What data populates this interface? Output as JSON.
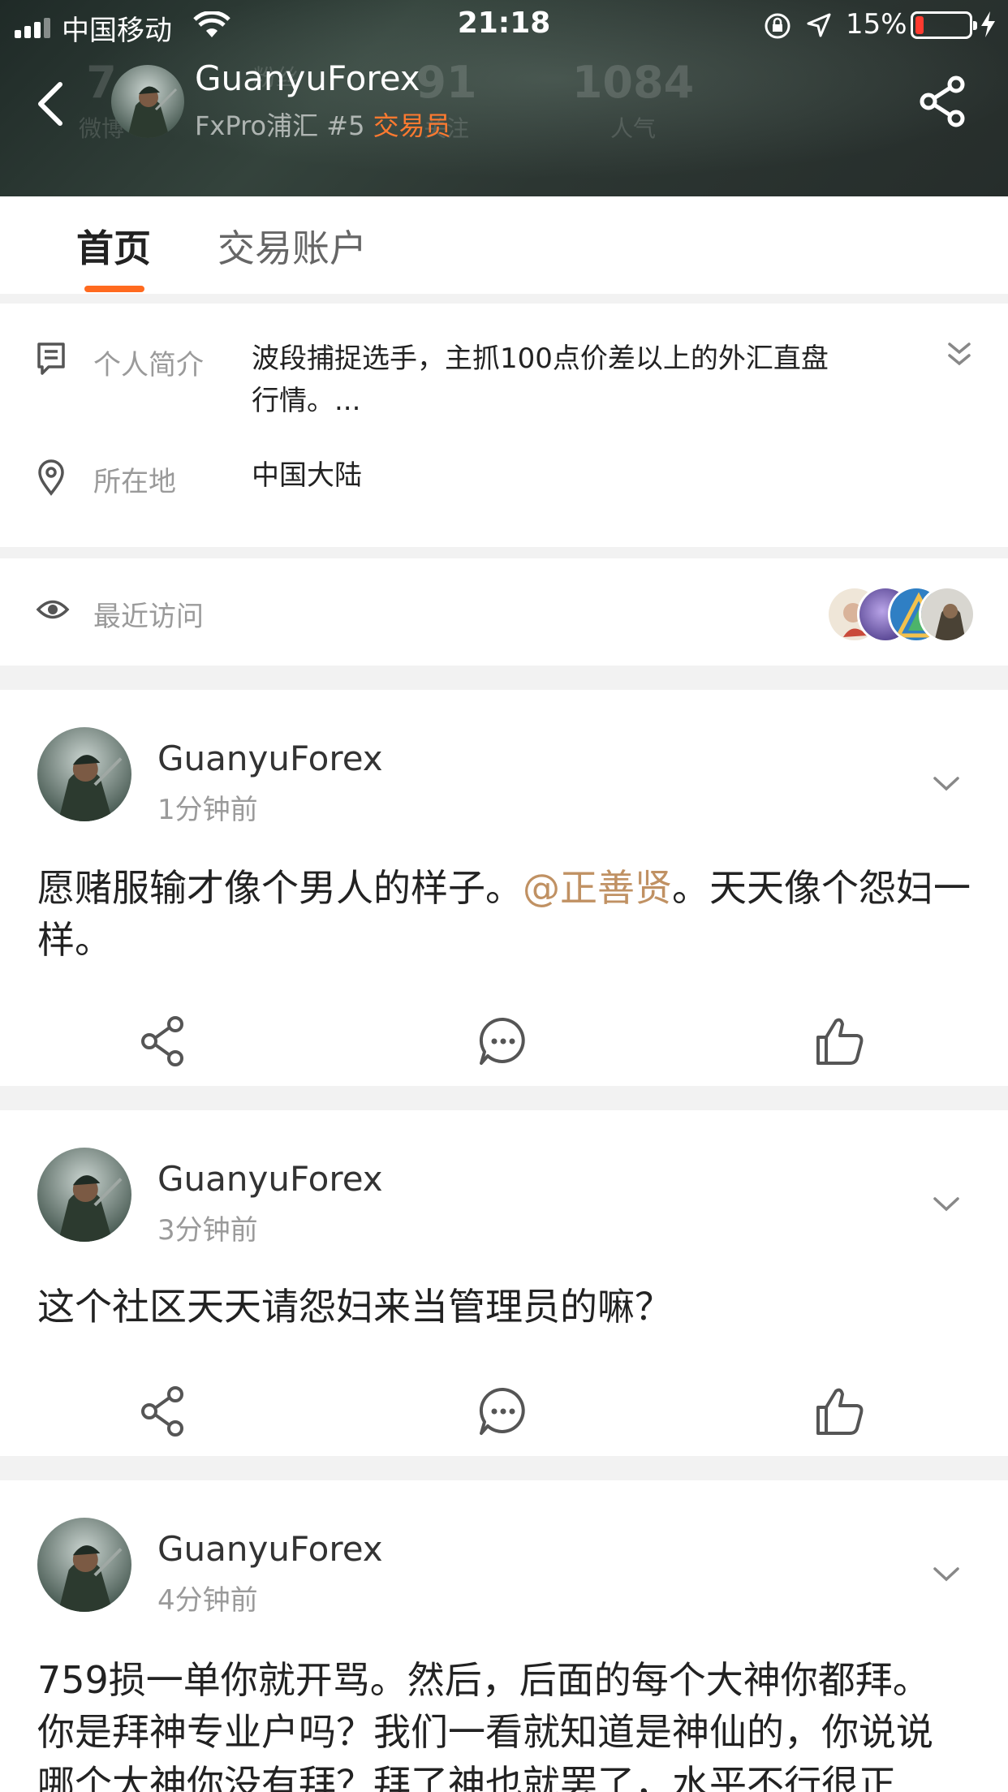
{
  "status_bar": {
    "carrier": "中国移动",
    "time": "21:18",
    "battery_percent_label": "15%",
    "battery_level": 0.15,
    "battery_color": "#ff3b30"
  },
  "header": {
    "ghost_stats": [
      {
        "num": "7",
        "label": "微博"
      },
      {
        "num": "",
        "label": "粉丝"
      },
      {
        "num": "91",
        "label": "关注"
      },
      {
        "num": "1084",
        "label": "人气"
      }
    ],
    "name": "GuanyuForex",
    "broker": "FxPro浦汇",
    "rank": "#5",
    "role": "交易员",
    "role_color": "#ff7a30"
  },
  "tabs": [
    {
      "label": "首页",
      "active": true
    },
    {
      "label": "交易账户",
      "active": false
    }
  ],
  "profile": {
    "bio_label": "个人简介",
    "bio_line1": "波段捕捉选手，主抓100点价差以上的外汇直盘",
    "bio_line2": "行情。...",
    "location_label": "所在地",
    "location_value": "中国大陆"
  },
  "recent_visits": {
    "label": "最近访问"
  },
  "posts": [
    {
      "author": "GuanyuForex",
      "time": "1分钟前",
      "text_before": "愿赌服输才像个男人的样子。",
      "mention": "@正善贤",
      "text_after": "。天天像个怨妇一样。"
    },
    {
      "author": "GuanyuForex",
      "time": "3分钟前",
      "text": "这个社区天天请怨妇来当管理员的嘛？"
    },
    {
      "author": "GuanyuForex",
      "time": "4分钟前",
      "text_line1": "759损一单你就开骂。然后，后面的每个大神你都拜。",
      "text_line2": "你是拜神专业户吗？我们一看就知道是神仙的，你说说",
      "text_line3": "哪个大神你没有拜？拜了神也就罢了，水平不行很正"
    }
  ],
  "colors": {
    "accent": "#ff6a1f",
    "mention": "#c09163"
  }
}
